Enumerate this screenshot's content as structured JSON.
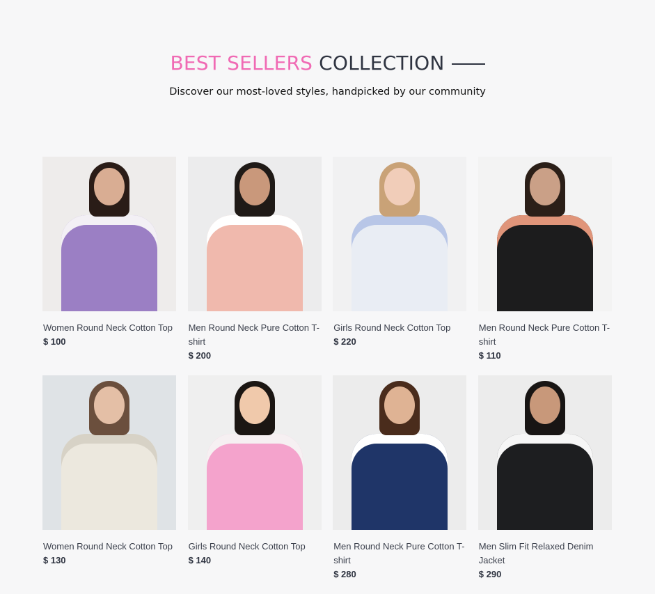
{
  "section": {
    "title_highlight": "BEST SELLERS",
    "title_rest": "COLLECTION",
    "subtitle": "Discover our most-loved styles, handpicked by our community"
  },
  "products": [
    {
      "title": "Women Round Neck Cotton Top",
      "price": "$ 100",
      "bg": "#eeeceb",
      "skin": "#d9ad93",
      "hair": "#2a1c17",
      "cloth": "#9b7fc4",
      "accent": "#f3f0f5"
    },
    {
      "title": "Men Round Neck Pure Cotton T-shirt",
      "price": "$ 200",
      "bg": "#ececed",
      "skin": "#c9987b",
      "hair": "#1f1a17",
      "cloth": "#f0b9ad",
      "accent": "#ffffff"
    },
    {
      "title": "Girls Round Neck Cotton Top",
      "price": "$ 220",
      "bg": "#f1f1f2",
      "skin": "#f1cdb9",
      "hair": "#c9a277",
      "cloth": "#e9edf4",
      "accent": "#b8c6e7"
    },
    {
      "title": "Men Round Neck Pure Cotton T-shirt",
      "price": "$ 110",
      "bg": "#f3f3f3",
      "skin": "#caa087",
      "hair": "#2b1f18",
      "cloth": "#1c1c1d",
      "accent": "#e0957a"
    },
    {
      "title": "Women Round Neck Cotton Top",
      "price": "$ 130",
      "bg": "#dfe3e6",
      "skin": "#e4bfa6",
      "hair": "#6b4f3d",
      "cloth": "#ece8de",
      "accent": "#d7d2c6"
    },
    {
      "title": "Girls Round Neck Cotton Top",
      "price": "$ 140",
      "bg": "#efefef",
      "skin": "#f0c9ab",
      "hair": "#1b1613",
      "cloth": "#f4a3cc",
      "accent": "#f6f0f2"
    },
    {
      "title": "Men Round Neck Pure Cotton T-shirt",
      "price": "$ 280",
      "bg": "#ececec",
      "skin": "#dfb394",
      "hair": "#4a2c1c",
      "cloth": "#1f3568",
      "accent": "#ffffff"
    },
    {
      "title": "Men Slim Fit Relaxed Denim Jacket",
      "price": "$ 290",
      "bg": "#ececec",
      "skin": "#c8987a",
      "hair": "#181514",
      "cloth": "#1d1e20",
      "accent": "#f6f6f6"
    }
  ]
}
